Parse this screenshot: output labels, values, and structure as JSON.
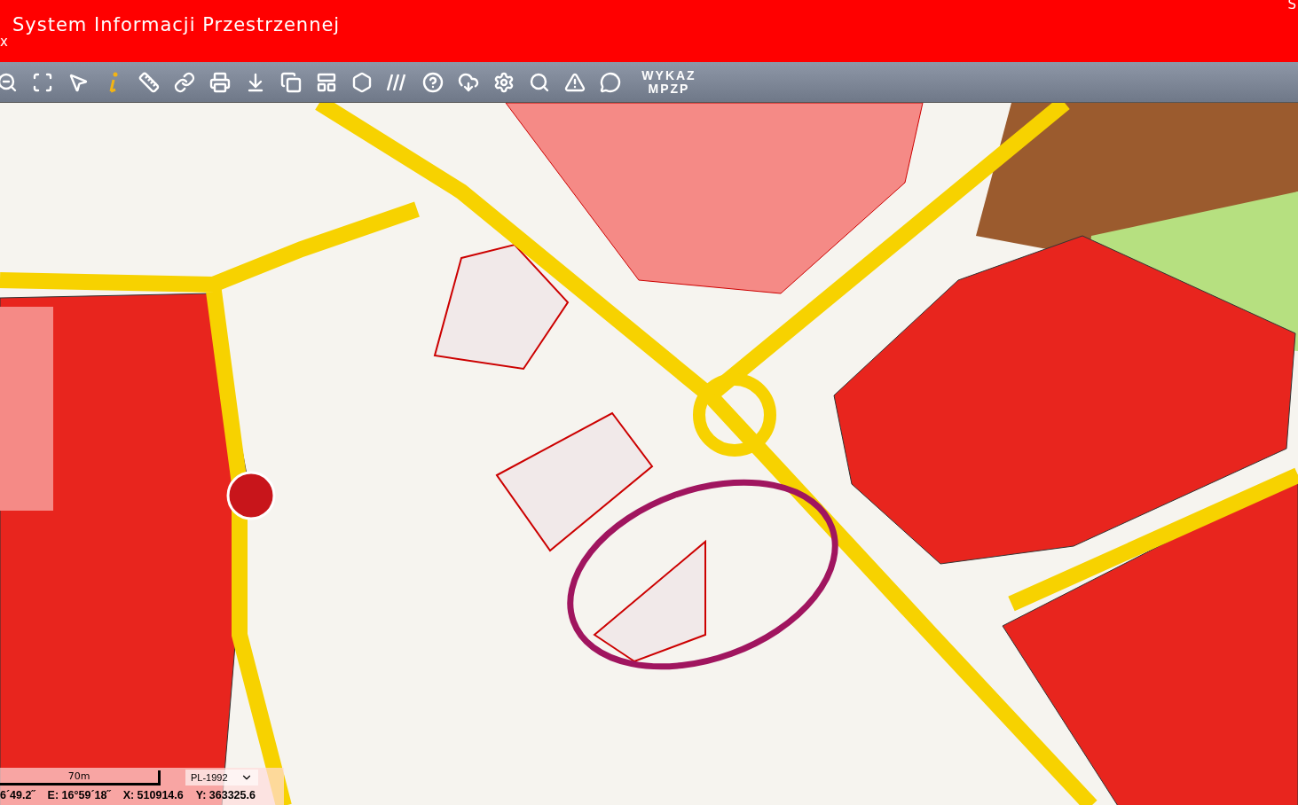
{
  "header": {
    "title": "System Informacji Przestrzennej",
    "corner_left": "x",
    "corner_right": "S"
  },
  "toolbar": {
    "wykaz_button": "WYKAZ MPZP"
  },
  "status": {
    "scale": "70m",
    "crs": "PL-1992",
    "coords": [
      "6´49.2˝",
      "E: 16°59´18˝",
      "X: 510914.6",
      "Y: 363325.6"
    ]
  }
}
